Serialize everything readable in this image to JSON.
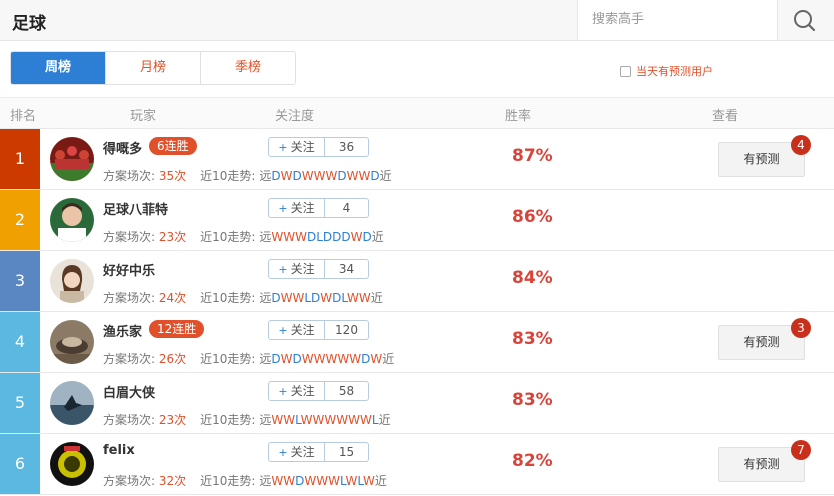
{
  "header": {
    "title": "足球",
    "search_placeholder": "搜索高手",
    "search_icon": "search-icon"
  },
  "tabs": [
    {
      "label": "周榜",
      "active": true
    },
    {
      "label": "月榜",
      "active": false
    },
    {
      "label": "季榜",
      "active": false
    }
  ],
  "filter": {
    "label": "当天有预测用户",
    "checked": false
  },
  "columns": {
    "rank": "排名",
    "player": "玩家",
    "attention": "关注度",
    "winrate": "胜率",
    "view": "查看"
  },
  "labels": {
    "follow": "关注",
    "plan_prefix": "方案场次:",
    "trend_prefix": "近10走势:",
    "predict": "有预测"
  },
  "colors": {
    "rank_colors": [
      "#cc3a00",
      "#f0a000",
      "#5a86c2",
      "#5bb8e0",
      "#5bb8e0",
      "#5bb8e0"
    ],
    "accent": "#e0502a",
    "primary": "#2d7fd6"
  },
  "players": [
    {
      "rank": "1",
      "name": "得嘅多",
      "streak": "6连胜",
      "plans": "35次",
      "trend": "远DWDWWWDWWD近",
      "follow_count": "36",
      "win_rate": "87%",
      "predict_count": "4"
    },
    {
      "rank": "2",
      "name": "足球八菲特",
      "streak": "",
      "plans": "23次",
      "trend": "远WWWDLDDDWD近",
      "follow_count": "4",
      "win_rate": "86%",
      "predict_count": ""
    },
    {
      "rank": "3",
      "name": "好好中乐",
      "streak": "",
      "plans": "24次",
      "trend": "远DWWLDWDLWW近",
      "follow_count": "34",
      "win_rate": "84%",
      "predict_count": ""
    },
    {
      "rank": "4",
      "name": "渔乐家",
      "streak": "12连胜",
      "plans": "26次",
      "trend": "远DWDWWWWWDW近",
      "follow_count": "120",
      "win_rate": "83%",
      "predict_count": "3"
    },
    {
      "rank": "5",
      "name": "白眉大侠",
      "streak": "",
      "plans": "23次",
      "trend": "远WWLWWWWWWL近",
      "follow_count": "58",
      "win_rate": "83%",
      "predict_count": ""
    },
    {
      "rank": "6",
      "name": "felix",
      "streak": "",
      "plans": "32次",
      "trend": "远WWDWWWLWLW近",
      "follow_count": "15",
      "win_rate": "82%",
      "predict_count": "7"
    }
  ]
}
